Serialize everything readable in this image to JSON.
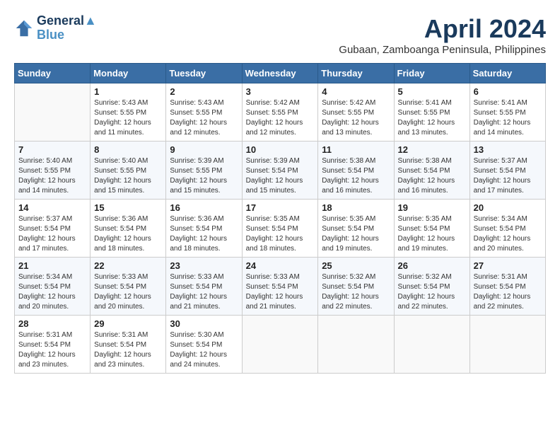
{
  "header": {
    "logo_line1": "General",
    "logo_line2": "Blue",
    "month_title": "April 2024",
    "subtitle": "Gubaan, Zamboanga Peninsula, Philippines"
  },
  "weekdays": [
    "Sunday",
    "Monday",
    "Tuesday",
    "Wednesday",
    "Thursday",
    "Friday",
    "Saturday"
  ],
  "weeks": [
    [
      {
        "day": null
      },
      {
        "day": 1,
        "sunrise": "5:43 AM",
        "sunset": "5:55 PM",
        "daylight": "12 hours and 11 minutes."
      },
      {
        "day": 2,
        "sunrise": "5:43 AM",
        "sunset": "5:55 PM",
        "daylight": "12 hours and 12 minutes."
      },
      {
        "day": 3,
        "sunrise": "5:42 AM",
        "sunset": "5:55 PM",
        "daylight": "12 hours and 12 minutes."
      },
      {
        "day": 4,
        "sunrise": "5:42 AM",
        "sunset": "5:55 PM",
        "daylight": "12 hours and 13 minutes."
      },
      {
        "day": 5,
        "sunrise": "5:41 AM",
        "sunset": "5:55 PM",
        "daylight": "12 hours and 13 minutes."
      },
      {
        "day": 6,
        "sunrise": "5:41 AM",
        "sunset": "5:55 PM",
        "daylight": "12 hours and 14 minutes."
      }
    ],
    [
      {
        "day": 7,
        "sunrise": "5:40 AM",
        "sunset": "5:55 PM",
        "daylight": "12 hours and 14 minutes."
      },
      {
        "day": 8,
        "sunrise": "5:40 AM",
        "sunset": "5:55 PM",
        "daylight": "12 hours and 15 minutes."
      },
      {
        "day": 9,
        "sunrise": "5:39 AM",
        "sunset": "5:55 PM",
        "daylight": "12 hours and 15 minutes."
      },
      {
        "day": 10,
        "sunrise": "5:39 AM",
        "sunset": "5:54 PM",
        "daylight": "12 hours and 15 minutes."
      },
      {
        "day": 11,
        "sunrise": "5:38 AM",
        "sunset": "5:54 PM",
        "daylight": "12 hours and 16 minutes."
      },
      {
        "day": 12,
        "sunrise": "5:38 AM",
        "sunset": "5:54 PM",
        "daylight": "12 hours and 16 minutes."
      },
      {
        "day": 13,
        "sunrise": "5:37 AM",
        "sunset": "5:54 PM",
        "daylight": "12 hours and 17 minutes."
      }
    ],
    [
      {
        "day": 14,
        "sunrise": "5:37 AM",
        "sunset": "5:54 PM",
        "daylight": "12 hours and 17 minutes."
      },
      {
        "day": 15,
        "sunrise": "5:36 AM",
        "sunset": "5:54 PM",
        "daylight": "12 hours and 18 minutes."
      },
      {
        "day": 16,
        "sunrise": "5:36 AM",
        "sunset": "5:54 PM",
        "daylight": "12 hours and 18 minutes."
      },
      {
        "day": 17,
        "sunrise": "5:35 AM",
        "sunset": "5:54 PM",
        "daylight": "12 hours and 18 minutes."
      },
      {
        "day": 18,
        "sunrise": "5:35 AM",
        "sunset": "5:54 PM",
        "daylight": "12 hours and 19 minutes."
      },
      {
        "day": 19,
        "sunrise": "5:35 AM",
        "sunset": "5:54 PM",
        "daylight": "12 hours and 19 minutes."
      },
      {
        "day": 20,
        "sunrise": "5:34 AM",
        "sunset": "5:54 PM",
        "daylight": "12 hours and 20 minutes."
      }
    ],
    [
      {
        "day": 21,
        "sunrise": "5:34 AM",
        "sunset": "5:54 PM",
        "daylight": "12 hours and 20 minutes."
      },
      {
        "day": 22,
        "sunrise": "5:33 AM",
        "sunset": "5:54 PM",
        "daylight": "12 hours and 20 minutes."
      },
      {
        "day": 23,
        "sunrise": "5:33 AM",
        "sunset": "5:54 PM",
        "daylight": "12 hours and 21 minutes."
      },
      {
        "day": 24,
        "sunrise": "5:33 AM",
        "sunset": "5:54 PM",
        "daylight": "12 hours and 21 minutes."
      },
      {
        "day": 25,
        "sunrise": "5:32 AM",
        "sunset": "5:54 PM",
        "daylight": "12 hours and 22 minutes."
      },
      {
        "day": 26,
        "sunrise": "5:32 AM",
        "sunset": "5:54 PM",
        "daylight": "12 hours and 22 minutes."
      },
      {
        "day": 27,
        "sunrise": "5:31 AM",
        "sunset": "5:54 PM",
        "daylight": "12 hours and 22 minutes."
      }
    ],
    [
      {
        "day": 28,
        "sunrise": "5:31 AM",
        "sunset": "5:54 PM",
        "daylight": "12 hours and 23 minutes."
      },
      {
        "day": 29,
        "sunrise": "5:31 AM",
        "sunset": "5:54 PM",
        "daylight": "12 hours and 23 minutes."
      },
      {
        "day": 30,
        "sunrise": "5:30 AM",
        "sunset": "5:54 PM",
        "daylight": "12 hours and 24 minutes."
      },
      {
        "day": null
      },
      {
        "day": null
      },
      {
        "day": null
      },
      {
        "day": null
      }
    ]
  ],
  "labels": {
    "sunrise": "Sunrise:",
    "sunset": "Sunset:",
    "daylight": "Daylight:"
  }
}
